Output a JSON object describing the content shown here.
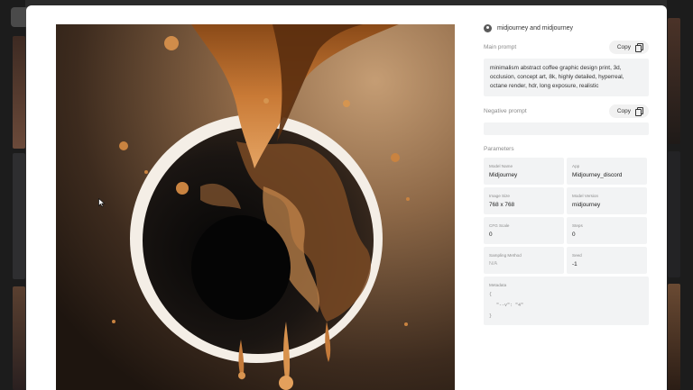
{
  "author": {
    "name": "midjourney and midjourney"
  },
  "main_prompt": {
    "label": "Main prompt",
    "copy_label": "Copy",
    "text": "minimalism abstract coffee graphic design print, 3d, occlusion, concept art, 8k, highly detailed, hyperreal, octane render, hdr, long exposure, realistic"
  },
  "negative_prompt": {
    "label": "Negative prompt",
    "copy_label": "Copy",
    "text": ""
  },
  "parameters": {
    "title": "Parameters",
    "items": [
      {
        "key": "Model Name",
        "value": "Midjourney"
      },
      {
        "key": "App",
        "value": "Midjourney_discord"
      },
      {
        "key": "Image Size",
        "value": "768 x 768"
      },
      {
        "key": "Model Version",
        "value": "midjourney"
      },
      {
        "key": "CFG Scale",
        "value": "0"
      },
      {
        "key": "Steps",
        "value": "0"
      },
      {
        "key": "Sampling Method",
        "value": "N/A"
      },
      {
        "key": "Seed",
        "value": "-1"
      }
    ],
    "metadata": {
      "key": "Metadata",
      "lines": [
        "{",
        "\"--v\": \"4\"",
        "}"
      ]
    }
  },
  "image": {
    "description_icon": "coffee-splash-artwork"
  },
  "colors": {
    "modal_bg": "#ffffff",
    "field_bg": "#f2f3f4",
    "label_gray": "#8a8a8a"
  }
}
